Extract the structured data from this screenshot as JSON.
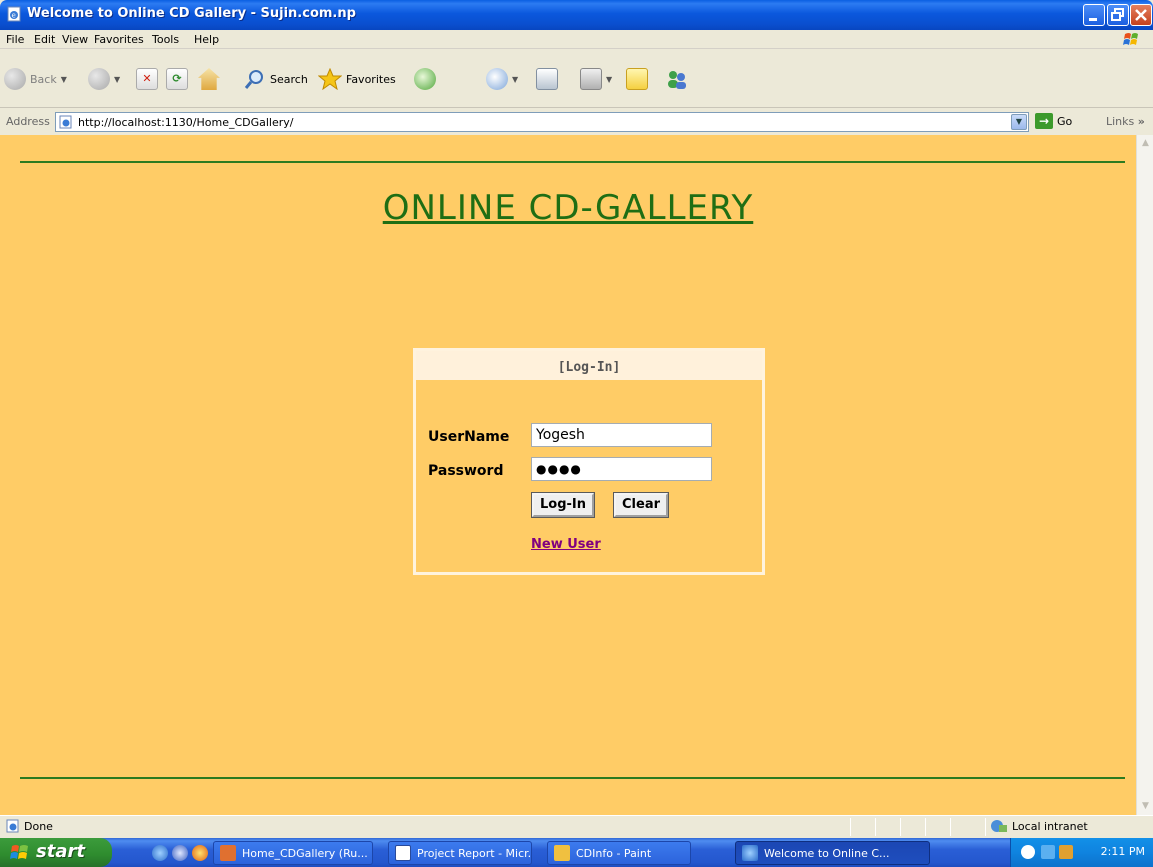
{
  "window": {
    "title": "Welcome to Online CD Gallery - Sujin.com.np"
  },
  "menu": {
    "items": [
      "File",
      "Edit",
      "View",
      "Favorites",
      "Tools",
      "Help"
    ]
  },
  "toolbar": {
    "back_label": "Back",
    "search_label": "Search",
    "favorites_label": "Favorites"
  },
  "address": {
    "label": "Address",
    "url": "http://localhost:1130/Home_CDGallery/",
    "go_label": "Go",
    "links_label": "Links"
  },
  "page": {
    "site_title": "ONLINE CD-GALLERY",
    "login": {
      "heading": "[Log-In]",
      "username_label": "UserName",
      "username_value": "Yogesh",
      "password_label": "Password",
      "password_value": "●●●●",
      "login_button": "Log-In",
      "clear_button": "Clear",
      "new_user_link": "New User"
    }
  },
  "statusbar": {
    "status_text": "Done",
    "zone_text": "Local intranet"
  },
  "taskbar": {
    "start_label": "start",
    "tasks": [
      {
        "label": "Home_CDGallery (Ru..."
      },
      {
        "label": "Project Report - Micr..."
      },
      {
        "label": "CDInfo - Paint"
      },
      {
        "label": "Welcome to Online C..."
      }
    ],
    "clock": "2:11 PM"
  },
  "colors": {
    "page_background": "#FFCC66",
    "title_green": "#1F6E14",
    "link_visited": "#800080"
  }
}
